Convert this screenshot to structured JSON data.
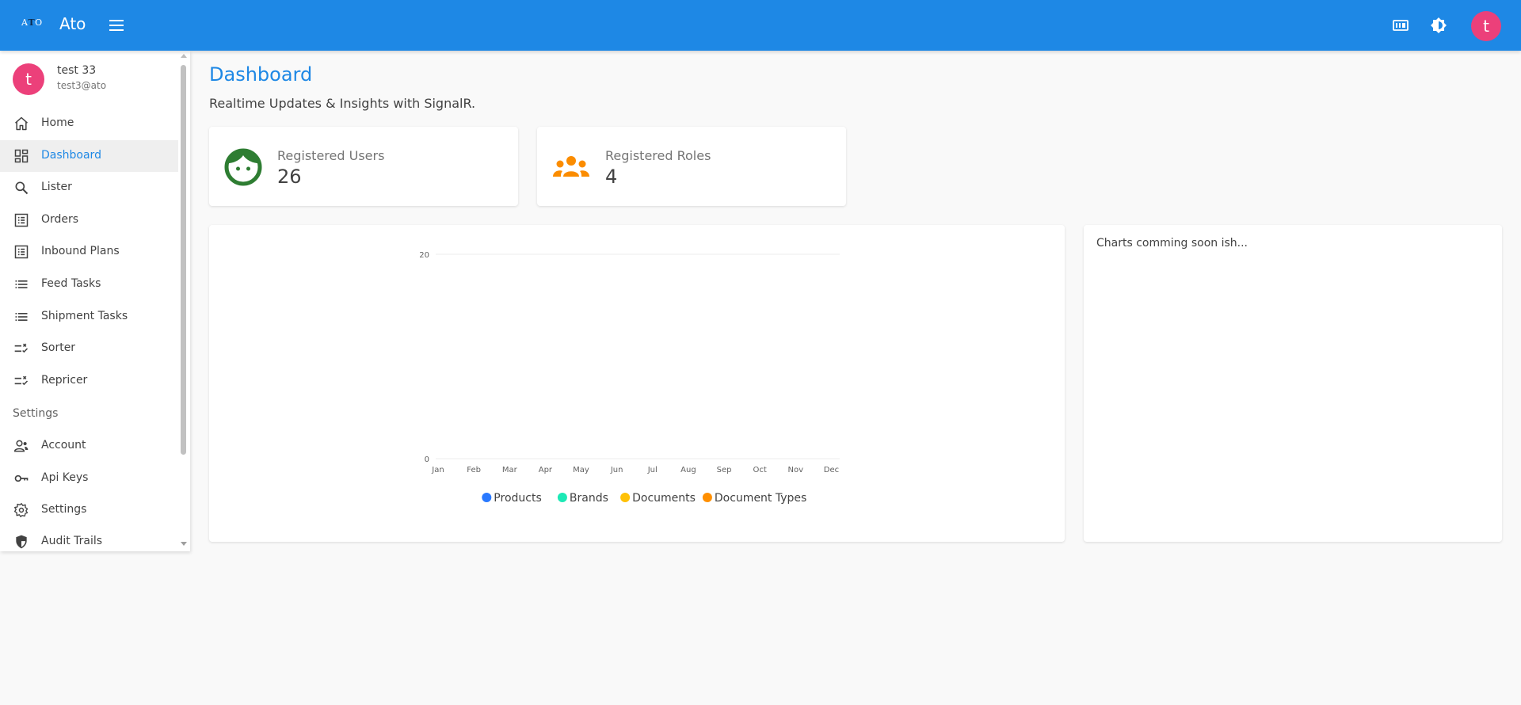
{
  "app": {
    "logo_text": "ATO",
    "name": "Ato"
  },
  "header": {
    "menu_icon": "menu-icon",
    "right_icons": [
      "keyboard-icon",
      "brightness-icon"
    ],
    "avatar_letter": "t"
  },
  "sidebar": {
    "user": {
      "avatar_letter": "t",
      "name": "test 33",
      "email": "test3@ato"
    },
    "items": [
      {
        "label": "Home",
        "icon": "home-icon"
      },
      {
        "label": "Dashboard",
        "icon": "dashboard-icon",
        "active": true
      },
      {
        "label": "Lister",
        "icon": "search-icon"
      },
      {
        "label": "Orders",
        "icon": "list-alt-icon"
      },
      {
        "label": "Inbound Plans",
        "icon": "list-alt-icon"
      },
      {
        "label": "Feed Tasks",
        "icon": "list-icon"
      },
      {
        "label": "Shipment Tasks",
        "icon": "list-icon"
      },
      {
        "label": "Sorter",
        "icon": "rule-icon"
      },
      {
        "label": "Repricer",
        "icon": "rule-icon"
      }
    ],
    "settings_section": "Settings",
    "settings_items": [
      {
        "label": "Account",
        "icon": "account-icon"
      },
      {
        "label": "Api Keys",
        "icon": "key-icon"
      },
      {
        "label": "Settings",
        "icon": "gear-icon"
      },
      {
        "label": "Audit Trails",
        "icon": "shield-icon"
      }
    ]
  },
  "main": {
    "title": "Dashboard",
    "subtitle": "Realtime Updates & Insights with SignalR.",
    "cards": [
      {
        "label": "Registered Users",
        "value": "26",
        "icon": "face-icon",
        "color": "#2e7d32"
      },
      {
        "label": "Registered Roles",
        "value": "4",
        "icon": "groups-icon",
        "color": "#fb8c00"
      }
    ],
    "side_card_text": "Charts comming soon ish..."
  },
  "chart_data": {
    "type": "line",
    "categories": [
      "Jan",
      "Feb",
      "Mar",
      "Apr",
      "May",
      "Jun",
      "Jul",
      "Aug",
      "Sep",
      "Oct",
      "Nov",
      "Dec"
    ],
    "y_ticks": [
      0,
      20
    ],
    "ylim": [
      0,
      20
    ],
    "series": [
      {
        "name": "Products",
        "color": "#2979ff",
        "values": []
      },
      {
        "name": "Brands",
        "color": "#1de9b6",
        "values": []
      },
      {
        "name": "Documents",
        "color": "#ffc107",
        "values": []
      },
      {
        "name": "Document Types",
        "color": "#ff8f00",
        "values": []
      }
    ],
    "legend": "bottom"
  },
  "colors": {
    "primary": "#1e88e5",
    "avatar": "#ec407a"
  }
}
